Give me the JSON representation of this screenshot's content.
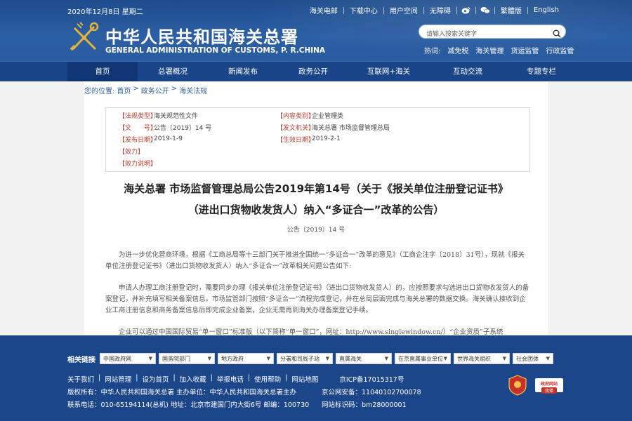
{
  "header": {
    "date": "2020年12月8日 星期二",
    "top_links": [
      "海关电邮",
      "下载中心",
      "用户空间",
      "无障碍"
    ],
    "english": "繁體版",
    "english2": "English",
    "brand_cn": "中华人民共和国海关总署",
    "brand_en": "GENERAL ADMINISTRATION OF CUSTOMS, P. R.CHINA",
    "search_placeholder": "请输入搜索关键字",
    "hot_label": "热词:",
    "hot_words": [
      "减免税",
      "海关管理",
      "货运监管",
      "行政监管"
    ]
  },
  "nav": {
    "items": [
      "首页",
      "总署概况",
      "新闻发布",
      "政务公开",
      "互联网+海关",
      "互动交流",
      "专题专栏"
    ]
  },
  "breadcrumb": [
    "您的位置:",
    "首页",
    ">",
    "政务公开",
    ">",
    "海关法规"
  ],
  "meta": {
    "rows": [
      {
        "l1": "【法规类型】",
        "v1": "海关规范性文件",
        "l2": "【内容类别】",
        "v2": "企业管理类"
      },
      {
        "l1": "【文　　号】",
        "v1": "公告〔2019〕14 号",
        "l2": "【发文机关】",
        "v2": "海关总署 市场监督管理总局"
      },
      {
        "l1": "【发布日期】",
        "v1": "2019-1-9",
        "l2": "【生效日期】",
        "v2": "2019-2-1"
      },
      {
        "l1": "【效力】",
        "v1": "",
        "l2": "",
        "v2": ""
      },
      {
        "l1": "【效力说明】",
        "v1": "",
        "l2": "",
        "v2": ""
      }
    ]
  },
  "document": {
    "title_line1": "海关总署 市场监督管理总局公告2019年第14号（关于《报关单位注册登记证书》",
    "title_line2": "（进出口货物收发货人）纳入“多证合一”改革的公告）",
    "doc_no": "公告〔2019〕14 号",
    "para1": "为进一步优化营商环境，根据《工商总局等十三部门关于推进全国统一“多证合一”改革的意见》（工商企注字〔2018〕31号），现就《报关单位注册登记证书》（进出口货物收发货人）纳入“多证合一”改革相关问题公告如下:",
    "para2": "申请人办理工商注册登记时，需要同步办理《报关单位注册登记证书》（进出口货物收发货人）的，应按照要求勾选进出口货物收发货人的备案登记，并补充填写相关备案信息。市场监管部门按照“多证合一”流程完成登记，并在总局层面完成与海关总署的数据交换。海关确认接收到企业工商注册信息和商务备案信息后即完成企业备案，企业无需再到海关办理备案登记手续。",
    "para3": "企业可以通过中国国际贸易“单一窗口”标准版（以下简称“单一窗口”，网址：http://www.singlewindow.cn/）“企业资质”子系统"
  },
  "footer": {
    "friend_label": "相关链接",
    "selects": [
      "中国政府网",
      "国务院部门",
      "地方政府",
      "分署和司局子站",
      "直属海关",
      "在京直属事业单位",
      "世界海关组织",
      "社会团体"
    ],
    "links": [
      "关于我们",
      "网站管理",
      "设为首页",
      "加入收藏",
      "举报电话",
      "使用帮助",
      "网站地图"
    ],
    "icp": "京ICP备17015317号",
    "sponsor": "版权所有：中华人民共和国海关总署 主办单位：中华人民共和国海关总署主办",
    "police": "京公网安备：11040102700078",
    "contact": "联系电话：010-65194114(总机) 地址：北京市建国门内大街6号 邮编：100730",
    "license": "网站标识码：bm28000001",
    "badge2_text": "政府网站",
    "badge2_sub": "找错"
  },
  "colors": {
    "brand_blue": "#1b468a",
    "nav_active": "#0f3573",
    "label_red": "#c0392b"
  }
}
